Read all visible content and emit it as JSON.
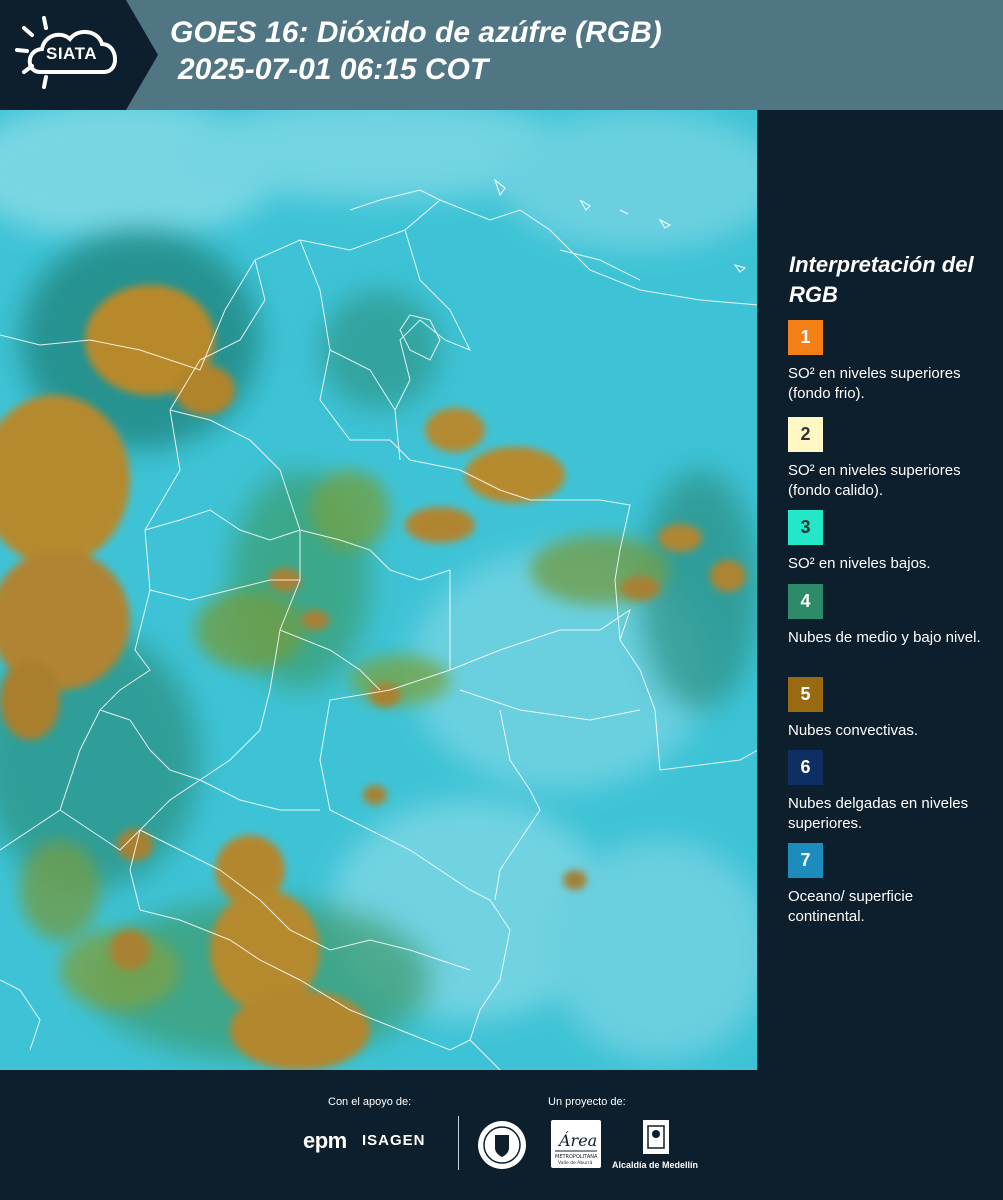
{
  "header": {
    "logo_text": "SIATA",
    "title_line1": "GOES 16: Dióxido de azúfre (RGB)",
    "title_line2": "2025-07-01 06:15 COT"
  },
  "legend": {
    "title": "Interpretación del RGB",
    "items": [
      {
        "number": "1",
        "color": "#f57f17",
        "label": "SO² en niveles superiores (fondo frio)."
      },
      {
        "number": "2",
        "color": "#fff7c4",
        "label": "SO² en niveles superiores (fondo calido)."
      },
      {
        "number": "3",
        "color": "#24e6c9",
        "label": "SO² en niveles bajos."
      },
      {
        "number": "4",
        "color": "#2e8b6a",
        "label": "Nubes de medio y bajo nivel."
      },
      {
        "number": "5",
        "color": "#9a6a12",
        "label": "Nubes convectivas."
      },
      {
        "number": "6",
        "color": "#0d2f63",
        "label": "Nubes delgadas en niveles superiores."
      },
      {
        "number": "7",
        "color": "#1b8cbc",
        "label": "Oceano/ superficie continental."
      }
    ]
  },
  "footer": {
    "support_label": "Con el apoyo de:",
    "project_label": "Un proyecto de:",
    "sponsor1": "epm",
    "sponsor2": "ISAGEN",
    "area_logo_text": "Área",
    "area_subtext": "METROPOLITANA",
    "area_subtext2": "Valle de Aburrá",
    "alcaldia": "Alcaldía de Medellín"
  },
  "colors": {
    "header_bg": "#507684",
    "panel_bg": "#0d1e2c",
    "map_cyan": "#3cc4d8",
    "cloud_brown": "#b58a2c"
  }
}
